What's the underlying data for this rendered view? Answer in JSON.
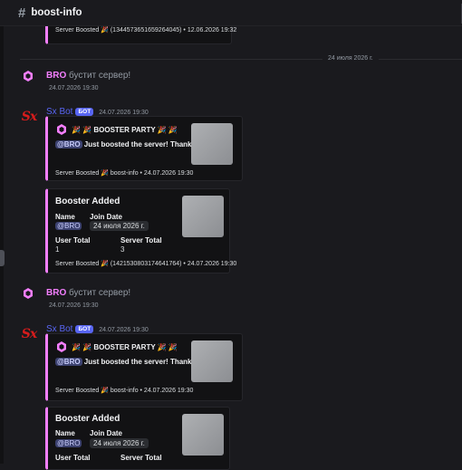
{
  "channel": {
    "name": "boost-info"
  },
  "colors": {
    "embed_accent": "#f47fff",
    "bot_badge": "#5865f2",
    "mention_bg": "#3c4270"
  },
  "top_embed": {
    "footer": "Server Boosted 🎉 (1344573651659264045) • 12.06.2026 19:32"
  },
  "date_divider": "24 июля 2026 г.",
  "groups": [
    {
      "system": {
        "user": "BRO",
        "text": " бустит сервер!",
        "time": "24.07.2026 19:30"
      },
      "bot": {
        "name": "Sx Bot",
        "badge": "БОТ",
        "time": "24.07.2026 19:30",
        "avatar_text": "Sx"
      },
      "party": {
        "title": "🎉 🎉 BOOSTER PARTY 🎉 🎉",
        "mention": "@BRO",
        "desc": " Just boosted the server! Thanks!",
        "footer": "Server Boosted 🎉 boost-info • 24.07.2026 19:30"
      },
      "added": {
        "title": "Booster Added",
        "name_label": "Name",
        "name_value": "@BRO",
        "join_label": "Join Date",
        "join_value": "24 июля 2026 г.",
        "user_total_label": "User Total",
        "user_total_value": "1",
        "server_total_label": "Server Total",
        "server_total_value": "3",
        "footer": "Server Boosted 🎉 (1421530803174641764) • 24.07.2026 19:30"
      }
    },
    {
      "system": {
        "user": "BRO",
        "text": " бустит сервер!",
        "time": "24.07.2026 19:30"
      },
      "bot": {
        "name": "Sx Bot",
        "badge": "БОТ",
        "time": "24.07.2026 19:30",
        "avatar_text": "Sx"
      },
      "party": {
        "title": "🎉 🎉 BOOSTER PARTY 🎉 🎉",
        "mention": "@BRO",
        "desc": " Just boosted the server! Thanks!",
        "footer": "Server Boosted 🎉 boost-info • 24.07.2026 19:30"
      },
      "added": {
        "title": "Booster Added",
        "name_label": "Name",
        "name_value": "@BRO",
        "join_label": "Join Date",
        "join_value": "24 июля 2026 г.",
        "user_total_label": "User Total",
        "server_total_label": "Server Total"
      }
    }
  ]
}
